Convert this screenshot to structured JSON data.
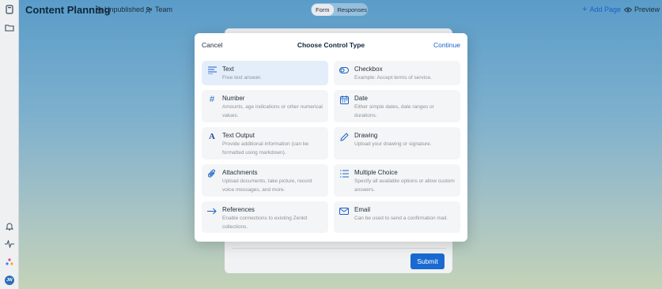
{
  "topbar": {
    "app_title": "Content Planning",
    "status": "Unpublished",
    "team": "Team",
    "tabs": [
      "Form",
      "Responses"
    ],
    "add_page": "Add Page",
    "preview": "Preview"
  },
  "sidebar": {
    "avatar_initials": "JW"
  },
  "form": {
    "submit_label": "Submit"
  },
  "modal": {
    "cancel": "Cancel",
    "title": "Choose Control Type",
    "continue": "Continue",
    "options": [
      {
        "title": "Text",
        "desc": "Free text answer.",
        "icon": "text-lines-icon"
      },
      {
        "title": "Checkbox",
        "desc": "Example: Accept terms of service.",
        "icon": "toggle-icon"
      },
      {
        "title": "Number",
        "desc": "Amounts, age indications or other numerical values.",
        "icon": "hash-icon"
      },
      {
        "title": "Date",
        "desc": "Either simple dates, date ranges or durations.",
        "icon": "calendar-icon"
      },
      {
        "title": "Text Output",
        "desc": "Provide additional information (can be formatted using markdown).",
        "icon": "letter-a-icon"
      },
      {
        "title": "Drawing",
        "desc": "Upload your drawing or signature.",
        "icon": "pencil-icon"
      },
      {
        "title": "Attachments",
        "desc": "Upload documents, take picture, record voice messages, and more.",
        "icon": "paperclip-icon"
      },
      {
        "title": "Multiple Choice",
        "desc": "Specify all available options or allow custom answers.",
        "icon": "list-icon"
      },
      {
        "title": "References",
        "desc": "Enable connections to existing Zenkit collections.",
        "icon": "arrow-right-icon"
      },
      {
        "title": "Email",
        "desc": "Can be used to send a confirmation mail.",
        "icon": "envelope-icon"
      }
    ]
  },
  "colors": {
    "accent": "#1a62c9",
    "selected_bg": "#e4eefa"
  }
}
